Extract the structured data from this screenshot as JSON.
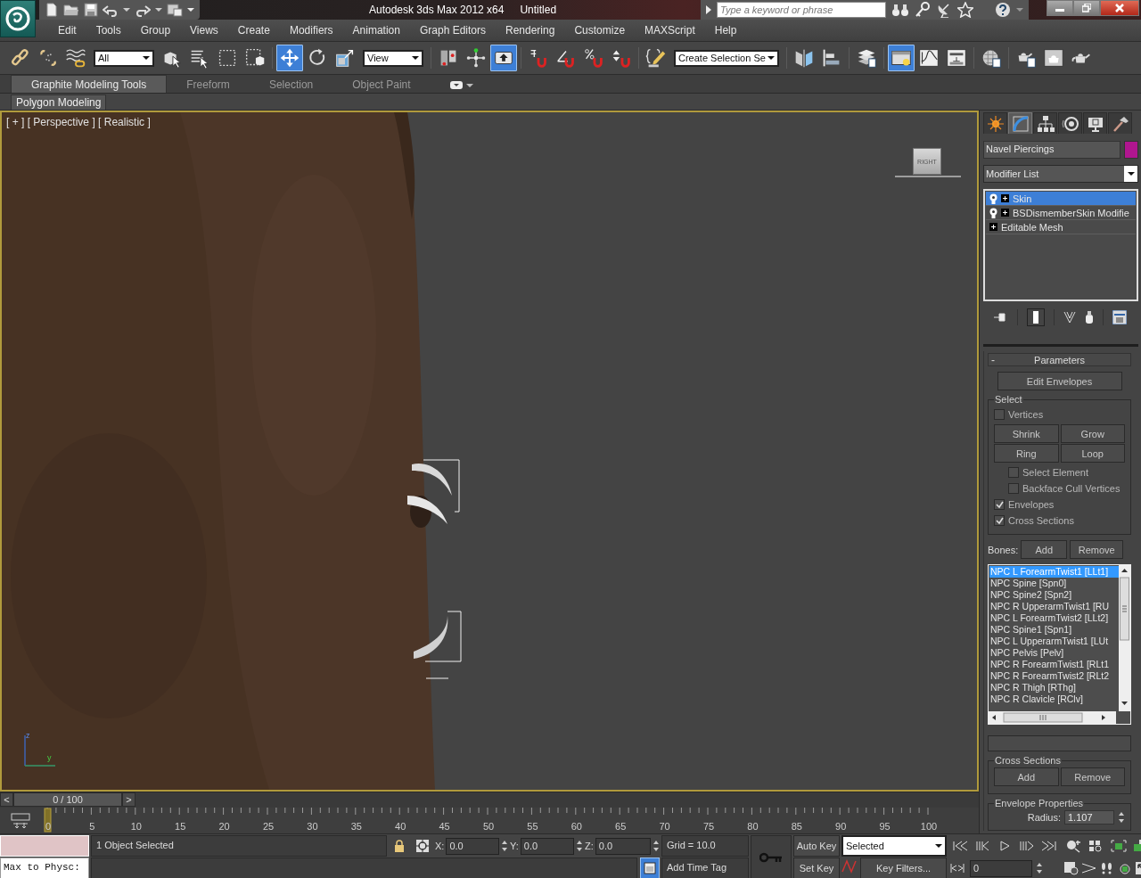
{
  "title_bar": {
    "title": "Autodesk 3ds Max  2012 x64",
    "document": "Untitled",
    "search": {
      "placeholder": "Type a keyword or phrase"
    }
  },
  "menu_bar": [
    "Edit",
    "Tools",
    "Group",
    "Views",
    "Create",
    "Modifiers",
    "Animation",
    "Graph Editors",
    "Rendering",
    "Customize",
    "MAXScript",
    "Help"
  ],
  "main_toolbar": {
    "items": [
      {
        "kind": "icon",
        "selected": false
      },
      {
        "kind": "icon",
        "selected": false
      },
      {
        "kind": "icon",
        "selected": false
      },
      {
        "kind": "dropdown",
        "value": "All"
      },
      {
        "kind": "icon",
        "selected": false
      },
      {
        "kind": "icon",
        "selected": false
      },
      {
        "kind": "icon",
        "selected": false
      },
      {
        "kind": "icon",
        "selected": false
      },
      {
        "kind": "icon",
        "selected": true
      },
      {
        "kind": "icon",
        "selected": false
      },
      {
        "kind": "icon",
        "selected": false
      },
      {
        "kind": "dropdown",
        "value": "View"
      },
      {
        "kind": "icon",
        "selected": false
      },
      {
        "kind": "icon",
        "selected": false
      },
      {
        "kind": "icon",
        "selected": true
      },
      {
        "kind": "icon",
        "selected": false
      },
      {
        "kind": "icon",
        "selected": false
      },
      {
        "kind": "icon",
        "selected": false
      },
      {
        "kind": "icon",
        "selected": false
      },
      {
        "kind": "icon",
        "selected": false
      },
      {
        "kind": "dropdown",
        "value": "Create Selection Se"
      },
      {
        "kind": "icon",
        "selected": false
      },
      {
        "kind": "icon",
        "selected": false
      },
      {
        "kind": "icon",
        "selected": false
      },
      {
        "kind": "icon",
        "selected": true
      },
      {
        "kind": "icon",
        "selected": false
      },
      {
        "kind": "icon",
        "selected": false
      },
      {
        "kind": "icon",
        "selected": false
      },
      {
        "kind": "icon",
        "selected": false
      },
      {
        "kind": "icon",
        "selected": false
      },
      {
        "kind": "icon",
        "selected": false
      }
    ]
  },
  "ribbon": {
    "tabs": [
      {
        "label": "Graphite Modeling Tools",
        "selected": true
      },
      {
        "label": "Freeform",
        "selected": false
      },
      {
        "label": "Selection",
        "selected": false
      },
      {
        "label": "Object Paint",
        "selected": false
      }
    ],
    "panel": "Polygon Modeling"
  },
  "viewport": {
    "label": "[ + ] [ Perspective ] [ Realistic ]",
    "viewcube": "RIGHT",
    "axes": [
      "z",
      "y"
    ]
  },
  "command_panel": {
    "tabs": [
      {
        "selected": false
      },
      {
        "selected": true
      },
      {
        "selected": false
      },
      {
        "selected": false
      },
      {
        "selected": false
      },
      {
        "selected": false
      }
    ],
    "object_name": "Navel Piercings",
    "modifier_list": "Modifier List",
    "stack": [
      {
        "label": "Skin",
        "kind": "modifier",
        "selected": true
      },
      {
        "label": "BSDismemberSkin Modifie",
        "kind": "modifier",
        "selected": false
      },
      {
        "label": "Editable Mesh",
        "kind": "base",
        "selected": false
      }
    ],
    "rollout": {
      "collapse": "-",
      "title": "Parameters",
      "edit_envelopes": "Edit Envelopes",
      "select": {
        "title": "Select",
        "options": [
          {
            "label": "Vertices",
            "checked": false,
            "kind": "main"
          },
          {
            "kind": "buttons",
            "buttons": [
              "Shrink",
              "Grow",
              "Ring",
              "Loop"
            ]
          },
          {
            "label": "Select Element",
            "checked": false,
            "kind": "sub"
          },
          {
            "label": "Backface Cull Vertices",
            "checked": false,
            "kind": "sub"
          },
          {
            "label": "Envelopes",
            "checked": true,
            "kind": "main"
          },
          {
            "label": "Cross Sections",
            "checked": true,
            "kind": "main"
          }
        ]
      },
      "bones": {
        "label": "Bones:",
        "buttons": [
          "Add",
          "Remove"
        ],
        "items": [
          {
            "label": "NPC L ForearmTwist1 [LLt1]",
            "selected": true
          },
          {
            "label": "NPC Spine [Spn0]",
            "selected": false
          },
          {
            "label": "NPC Spine2 [Spn2]",
            "selected": false
          },
          {
            "label": "NPC R UpperarmTwist1 [RU",
            "selected": false
          },
          {
            "label": "NPC L ForearmTwist2 [LLt2]",
            "selected": false
          },
          {
            "label": "NPC Spine1 [Spn1]",
            "selected": false
          },
          {
            "label": "NPC L UpperarmTwist1 [LUt",
            "selected": false
          },
          {
            "label": "NPC Pelvis [Pelv]",
            "selected": false
          },
          {
            "label": "NPC R ForearmTwist1 [RLt1",
            "selected": false
          },
          {
            "label": "NPC R ForearmTwist2 [RLt2",
            "selected": false
          },
          {
            "label": "NPC R Thigh [RThg]",
            "selected": false
          },
          {
            "label": "NPC R Clavicle [RClv]",
            "selected": false
          }
        ]
      },
      "cross_sections": {
        "title": "Cross Sections",
        "buttons": [
          "Add",
          "Remove"
        ]
      },
      "envelope_properties": {
        "title": "Envelope Properties",
        "radius_label": "Radius:",
        "radius": "1.107"
      }
    }
  },
  "timeline": {
    "slider": {
      "prev": "<",
      "label": "0 / 100",
      "next": ">",
      "level": 0
    },
    "ticks": [
      "0",
      "5",
      "10",
      "15",
      "20",
      "25",
      "30",
      "35",
      "40",
      "45",
      "50",
      "55",
      "60",
      "65",
      "70",
      "75",
      "80",
      "85",
      "90",
      "95",
      "100"
    ]
  },
  "status": {
    "listener_input": "Max to Physc:",
    "prompt": "1 Object Selected",
    "coords": [
      {
        "axis": "X:",
        "value": "0.0"
      },
      {
        "axis": "Y:",
        "value": "0.0"
      },
      {
        "axis": "Z:",
        "value": "0.0"
      }
    ],
    "grid": "Grid = 10.0",
    "add_time_tag": "Add Time Tag",
    "auto_key": "Auto Key",
    "set_key": "Set Key",
    "key_mode": "Selected",
    "key_filters": "Key Filters...",
    "frame": "0"
  }
}
